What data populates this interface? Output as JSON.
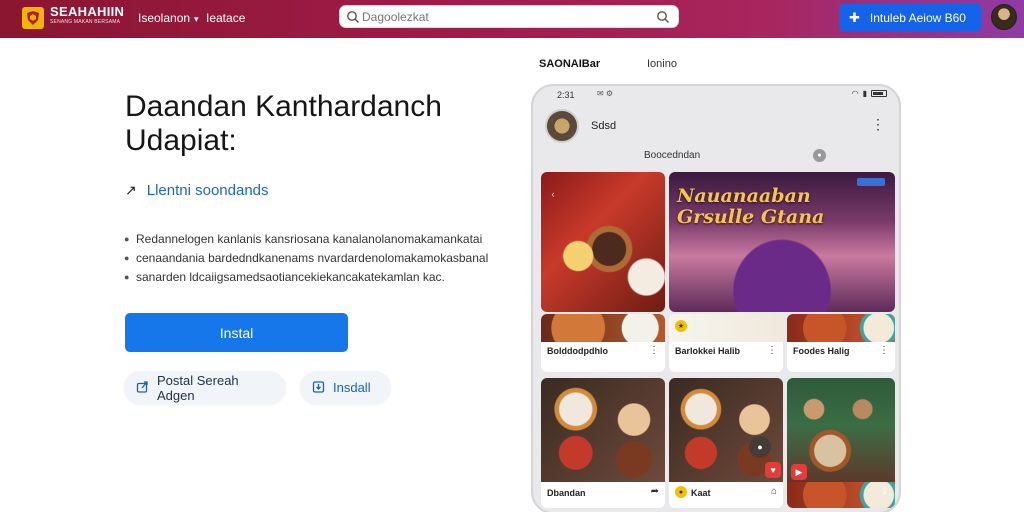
{
  "header": {
    "brand_title": "SEAHAHIIN",
    "brand_sub": "SENANG MAKAN BERSAMA",
    "nav": [
      {
        "label": "Iseolanon",
        "dropdown": true
      },
      {
        "label": "Ieatace",
        "dropdown": false
      }
    ],
    "search_placeholder": "Dagoolezkat",
    "cta_label": "Intuleb Aeiow B60",
    "colors": {
      "bar_start": "#8a1630",
      "bar_end": "#8f3aa6",
      "cta": "#1463e8"
    }
  },
  "hero": {
    "title": "Daandan Kanthardanch Udapiat:",
    "subhead": "Llentni soondands",
    "bullets": [
      "Redannelogen kanlanis kansriosana kanalanolanomakamankatai",
      "cenaandania bardedndkanenams nvardardenolomakamokasbanal",
      "sanarden ldcaiigsamedsaotiancekiekancakatekamlan kac."
    ],
    "install_label": "Instal",
    "pill_1": "Postal Sereah Adgen",
    "pill_2": "Insdall"
  },
  "preview": {
    "tabs": [
      "SAONAIBar",
      "Ionino"
    ],
    "status_time": "2:31",
    "channel_name": "Sdsd",
    "search_label": "Boocedndan",
    "heritage_title": "Nauanaaban Grsulle Gtana",
    "cards": [
      {
        "caption": "Bolddodpdhlo"
      },
      {
        "caption": "Barlokkei Halib"
      },
      {
        "caption": "Foodes Halig"
      },
      {
        "caption": "Dbandan"
      },
      {
        "caption": "Kaat"
      },
      {
        "caption": ""
      }
    ]
  }
}
